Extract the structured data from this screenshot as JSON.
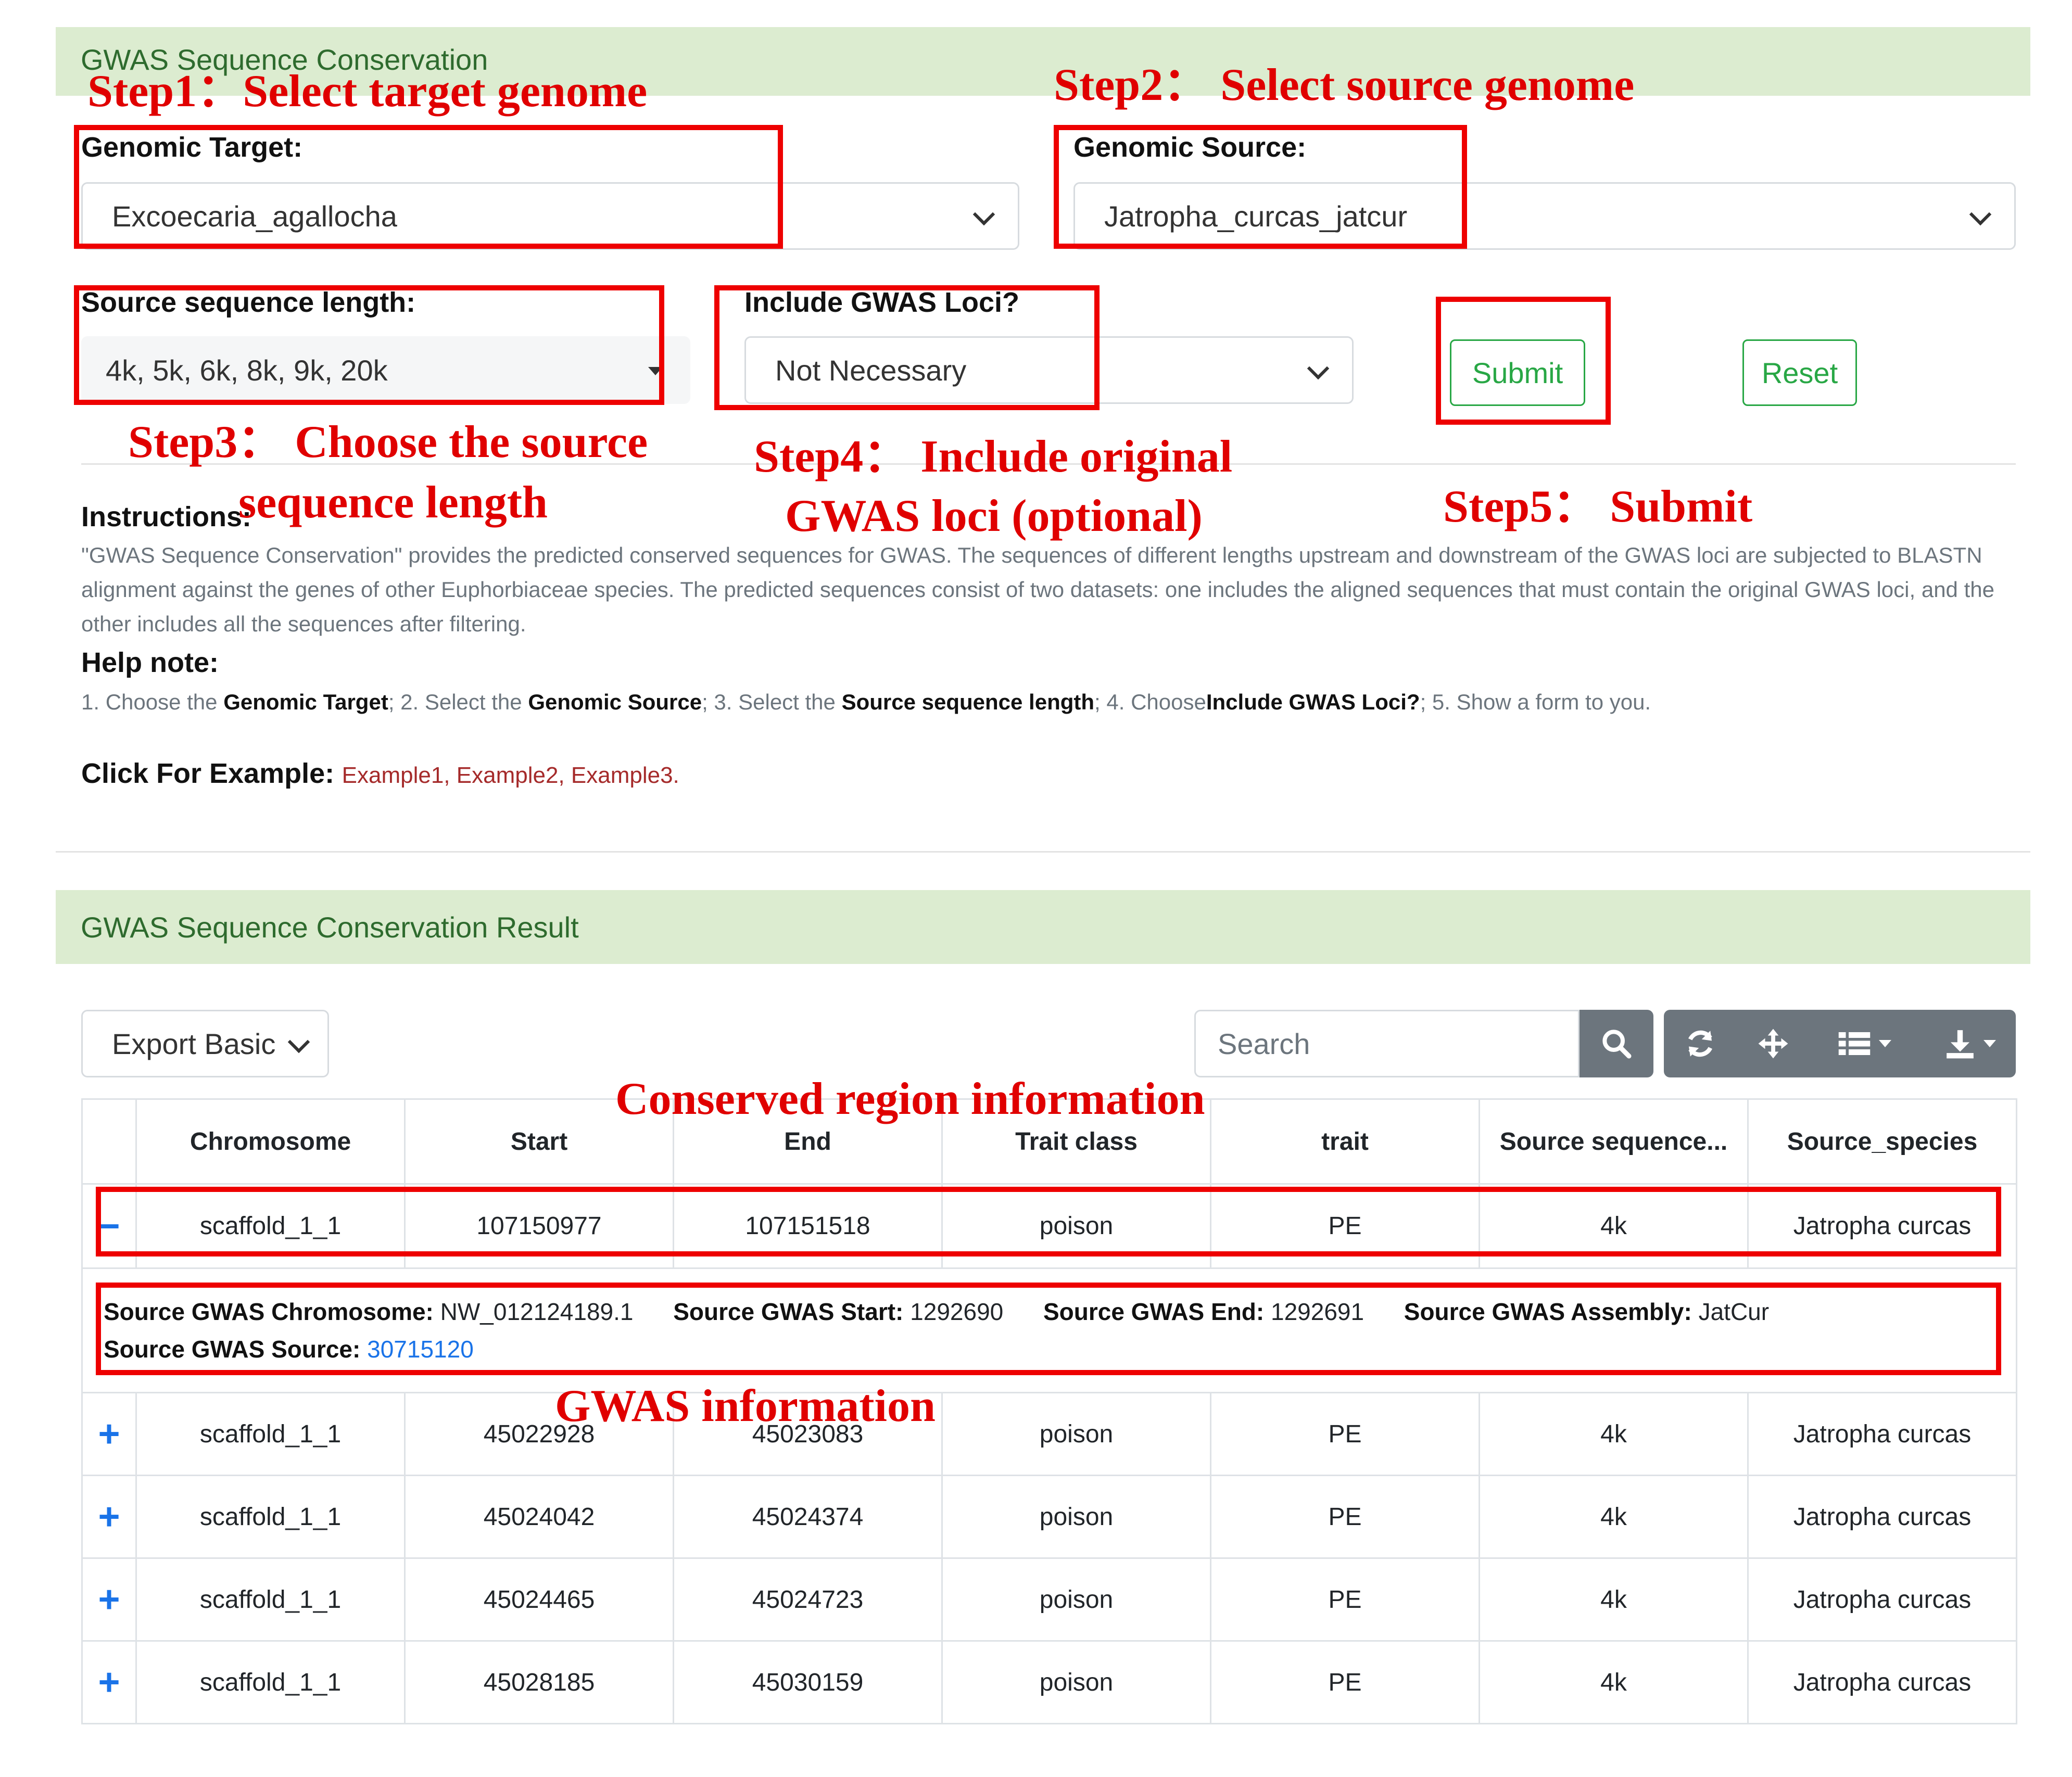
{
  "form_panel": {
    "title": "GWAS Sequence Conservation",
    "genomic_target": {
      "label": "Genomic Target:",
      "value": "Excoecaria_agallocha"
    },
    "genomic_source": {
      "label": "Genomic Source:",
      "value": "Jatropha_curcas_jatcur"
    },
    "source_length": {
      "label": "Source sequence length:",
      "value": "4k, 5k, 6k, 8k, 9k, 20k"
    },
    "include_loci": {
      "label": "Include GWAS Loci?",
      "value": "Not Necessary"
    },
    "submit_label": "Submit",
    "reset_label": "Reset"
  },
  "instructions": {
    "heading": "Instructions:",
    "text": "\"GWAS Sequence Conservation\" provides the predicted conserved sequences for GWAS. The sequences of different lengths upstream and downstream of the GWAS loci are subjected to BLASTN alignment against the genes of other Euphorbiaceae species. The predicted sequences consist of two datasets: one includes the aligned sequences that must contain the original GWAS loci, and the other includes all the sequences after filtering."
  },
  "help": {
    "heading": "Help note:",
    "p1": "1. Choose the ",
    "b1": "Genomic Target",
    "p2": "; 2. Select the ",
    "b2": "Genomic Source",
    "p3": "; 3. Select the ",
    "b3": "Source sequence length",
    "p4": "; 4. Choose",
    "b4": "Include GWAS Loci?",
    "p5": "; 5. Show a form to you."
  },
  "examples": {
    "label": "Click For Example:",
    "items": [
      "Example1",
      "Example2",
      "Example3"
    ],
    "sep": ", ",
    "end": "."
  },
  "result_panel": {
    "title": "GWAS Sequence Conservation Result",
    "export_label": "Export Basic",
    "search_placeholder": "Search",
    "columns": [
      "Chromosome",
      "Start",
      "End",
      "Trait class",
      "trait",
      "Source sequence...",
      "Source_species"
    ],
    "expanded_row": {
      "toggle": "−",
      "cells": [
        "scaffold_1_1",
        "107150977",
        "107151518",
        "poison",
        "PE",
        "4k",
        "Jatropha curcas"
      ]
    },
    "detail": {
      "chrom_label": "Source GWAS Chromosome:",
      "chrom_value": "NW_012124189.1",
      "start_label": "Source GWAS Start:",
      "start_value": "1292690",
      "end_label": "Source GWAS End:",
      "end_value": "1292691",
      "assembly_label": "Source GWAS Assembly:",
      "assembly_value": "JatCur",
      "source_label": "Source GWAS Source:",
      "source_value": "30715120"
    },
    "rows": [
      {
        "toggle": "+",
        "cells": [
          "scaffold_1_1",
          "45022928",
          "45023083",
          "poison",
          "PE",
          "4k",
          "Jatropha curcas"
        ]
      },
      {
        "toggle": "+",
        "cells": [
          "scaffold_1_1",
          "45024042",
          "45024374",
          "poison",
          "PE",
          "4k",
          "Jatropha curcas"
        ]
      },
      {
        "toggle": "+",
        "cells": [
          "scaffold_1_1",
          "45024465",
          "45024723",
          "poison",
          "PE",
          "4k",
          "Jatropha curcas"
        ]
      },
      {
        "toggle": "+",
        "cells": [
          "scaffold_1_1",
          "45028185",
          "45030159",
          "poison",
          "PE",
          "4k",
          "Jatropha curcas"
        ]
      }
    ]
  },
  "annotations": {
    "step1": "Step1：Select target genome",
    "step2": "Step2：  Select source genome",
    "step3_l1": "Step3：  Choose the source",
    "step3_l2": "sequence length",
    "step4_l1": "Step4：  Include original",
    "step4_l2": "GWAS loci (optional)",
    "step5": "Step5：  Submit",
    "conserved": "Conserved region information",
    "gwas": "GWAS information"
  },
  "colors": {
    "panel_header_bg": "#dcecd0",
    "panel_header_text": "#2e6b2e",
    "annotation_red": "#e00000",
    "submit_green": "#28a745",
    "toolbar_gray": "#6c757d",
    "link_blue": "#1a73e8",
    "example_red": "#a52a2a"
  },
  "icons": [
    "search-icon",
    "refresh-icon",
    "move-icon",
    "columns-icon",
    "download-icon",
    "chevron-down-icon",
    "caret-down-icon"
  ]
}
